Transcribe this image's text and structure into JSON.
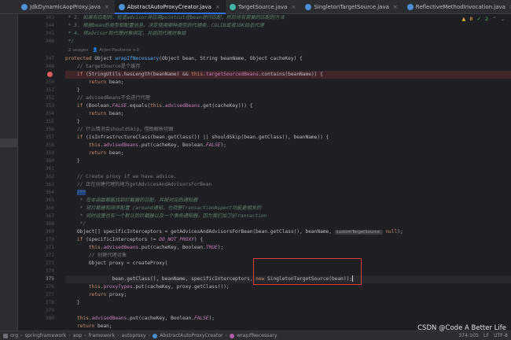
{
  "tabs": [
    {
      "label": "JdkDynamicAopProxy.java",
      "icon": "class-file-icon",
      "active": false
    },
    {
      "label": "AbstractAutoProxyCreator.java",
      "icon": "class-file-icon",
      "active": true
    },
    {
      "label": "TargetSource.java",
      "icon": "interface-file-icon",
      "active": false
    },
    {
      "label": "SingletonTargetSource.java",
      "icon": "class-file-icon",
      "active": false
    },
    {
      "label": "ReflectiveMethodInvocation.java",
      "icon": "class-file-icon",
      "active": false
    }
  ],
  "status": {
    "warnings": "8",
    "ok": "2"
  },
  "editor": {
    "doc_top": [
      " * 2. 如果有匹配的，检查advisor并应用pointcut在bean进行匹配，然后将有需要的匹配的方法",
      " * 3. 根据bean的类型和配置信息，决定使用哪种类型的代理类，CGLIB或者JDK动态代理",
      " * 4. 将advisor和代理对象绑定，并返回代理对象给",
      " */"
    ],
    "usages": "2 usages",
    "author": "Arjen Poutsma +3",
    "method_sig": {
      "kw1": "protected",
      "type": "Object",
      "name": "wrapIfNecessary",
      "params": "(Object bean, String beanName, Object cacheKey) {"
    },
    "c_target": "// targetSource是个缓存",
    "c_advised": "// advisedBeans不会进行代理",
    "c_skip": "// 什么情况会shouldSkip，借助解析切面",
    "c_create_en": "// Create proxy if we have advice.",
    "c_create_cn": "// 正在创建代理的地方getAdvicesAndAdvisorsForBean",
    "doc2_open": "/**",
    "doc2": [
      " * 在本函数都能找到拦截器的匹配，并按对应的通知器",
      " * 将拦截器和顺序配置 /around通知，也就是TransactionAspect功能更相关的",
      " * 同时这里也有一个默认的拦截器以及一个事务通知器，因为我们加了@Transaction",
      " */"
    ],
    "param_hint": "customTargetSource:",
    "c_proxy_obj": "// 创建代理对象"
  },
  "line_numbers": [
    "343",
    "344",
    "345",
    "346",
    "347",
    "",
    "347",
    "348",
    "349",
    "350",
    "351",
    "352",
    "353",
    "354",
    "355",
    "356",
    "357",
    "358",
    "359",
    "360",
    "361",
    "362",
    "363",
    "364",
    "365",
    "366",
    "367",
    "368",
    "369",
    "370",
    "371",
    "372",
    "373",
    "374",
    "375",
    "376",
    "377",
    "378",
    "379",
    "380"
  ],
  "breadcrumb": [
    "org",
    "springframework",
    "aop",
    "framework",
    "autoproxy",
    "AbstractAutoProxyCreator",
    "wrapIfNecessary"
  ],
  "status_right": [
    "374:105",
    "LF",
    "UTF-8"
  ],
  "watermark": "CSDN @Code A Better Life"
}
